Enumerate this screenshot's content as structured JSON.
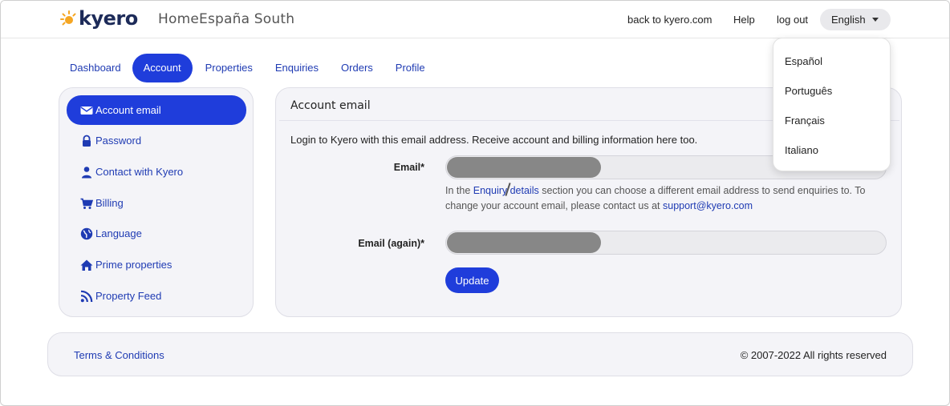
{
  "brand": {
    "logo_text": "kyero",
    "agency_name": "HomeEspaña South"
  },
  "header": {
    "back_link": "back to kyero.com",
    "help_link": "Help",
    "logout_link": "log out",
    "language": {
      "selected": "English",
      "options": [
        "Español",
        "Português",
        "Français",
        "Italiano"
      ]
    }
  },
  "tabs": [
    {
      "label": "Dashboard",
      "active": false
    },
    {
      "label": "Account",
      "active": true
    },
    {
      "label": "Properties",
      "active": false
    },
    {
      "label": "Enquiries",
      "active": false
    },
    {
      "label": "Orders",
      "active": false
    },
    {
      "label": "Profile",
      "active": false
    }
  ],
  "sidebar": {
    "items": [
      {
        "label": "Account email",
        "icon": "envelope-icon",
        "active": true
      },
      {
        "label": "Password",
        "icon": "lock-icon",
        "active": false
      },
      {
        "label": "Contact with Kyero",
        "icon": "user-icon",
        "active": false
      },
      {
        "label": "Billing",
        "icon": "cart-icon",
        "active": false
      },
      {
        "label": "Language",
        "icon": "globe-icon",
        "active": false
      },
      {
        "label": "Prime properties",
        "icon": "home-icon",
        "active": false
      },
      {
        "label": "Property Feed",
        "icon": "rss-icon",
        "active": false
      }
    ]
  },
  "main": {
    "title": "Account email",
    "description": "Login to Kyero with this email address. Receive account and billing information here too.",
    "email_label": "Email*",
    "email_again_label": "Email (again)*",
    "hint": {
      "before": "In the ",
      "link": "Enquiry details",
      "middle": " section you can choose a different email address to send enquiries to. To change your account email, please contact us at ",
      "email": "support@kyero.com"
    },
    "update_label": "Update"
  },
  "footer": {
    "terms": "Terms & Conditions",
    "copyright": "© 2007-2022 All rights reserved"
  },
  "colors": {
    "accent": "#1f3ddb",
    "link": "#1f3bb3",
    "panel_bg": "#f4f4f8",
    "logo_sun": "#f5a623"
  }
}
